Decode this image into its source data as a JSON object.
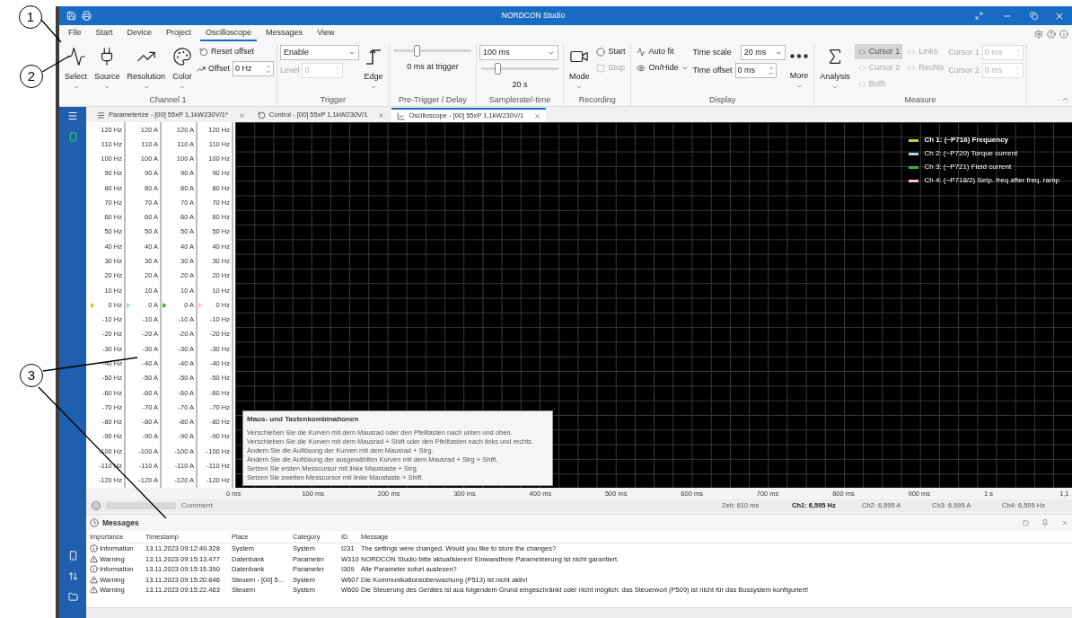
{
  "callouts": [
    {
      "label": "1"
    },
    {
      "label": "2"
    },
    {
      "label": "3"
    }
  ],
  "window": {
    "title": "NORDCON Studio"
  },
  "menu_tabs": [
    {
      "label": "File",
      "selected": false
    },
    {
      "label": "Start",
      "selected": false
    },
    {
      "label": "Device",
      "selected": false
    },
    {
      "label": "Project",
      "selected": false
    },
    {
      "label": "Oscilloscope",
      "selected": true
    },
    {
      "label": "Messages",
      "selected": false
    },
    {
      "label": "View",
      "selected": false
    }
  ],
  "ribbon": {
    "groups": [
      {
        "label": "Channel 1",
        "columns": [
          [
            {
              "kind": "big",
              "label": "Select"
            }
          ],
          [
            {
              "kind": "big",
              "label": "Source"
            }
          ],
          [
            {
              "kind": "big",
              "label": "Resolution"
            }
          ],
          [
            {
              "kind": "big",
              "label": "Color"
            }
          ],
          [
            {
              "kind": "small",
              "label": "Reset offset",
              "dropdown": false
            },
            {
              "kind": "spin",
              "label": "Offset",
              "value": "0 Hz"
            }
          ]
        ]
      },
      {
        "label": "Trigger",
        "columns": [
          [
            {
              "kind": "dropdown",
              "value": "Enable",
              "disabled": false
            },
            {
              "kind": "spin",
              "label": "Level",
              "value": "0",
              "disabled": true
            }
          ],
          [
            {
              "kind": "big",
              "label": "Edge"
            }
          ]
        ]
      },
      {
        "label": "Pre-Trigger / Delay",
        "columns": [
          [
            {
              "kind": "slider",
              "level": 0.28
            },
            {
              "kind": "caption",
              "label": "0 ms at trigger"
            }
          ]
        ]
      },
      {
        "label": "Samplerate/-time",
        "columns": [
          [
            {
              "kind": "dropdown",
              "value": "100 ms"
            },
            {
              "kind": "slider",
              "level": 0.2
            },
            {
              "kind": "caption",
              "label": "20 s"
            }
          ]
        ]
      },
      {
        "label": "Recording",
        "columns": [
          [
            {
              "kind": "big",
              "label": "Mode"
            }
          ],
          [
            {
              "kind": "small",
              "label": "Start",
              "dropdown": false,
              "disabled": false
            },
            {
              "kind": "small",
              "label": "Stop",
              "dropdown": false,
              "disabled": true
            }
          ]
        ]
      },
      {
        "label": "Display",
        "columns": [
          [
            {
              "kind": "small",
              "label": "Auto fit",
              "dropdown": false
            },
            {
              "kind": "small",
              "label": "On/Hide",
              "dropdown": true
            }
          ],
          [
            {
              "kind": "dropdown",
              "label": "Time scale",
              "value": "20 ms"
            },
            {
              "kind": "spin",
              "label": "Time offset",
              "value": "0 ms"
            }
          ],
          [
            {
              "kind": "big",
              "label": "More"
            }
          ]
        ]
      },
      {
        "label": "Measure",
        "columns": [
          [
            {
              "kind": "big",
              "label": "Analysis"
            }
          ],
          [
            {
              "kind": "toggle",
              "label": "Cursor 1",
              "selected": true,
              "disabled": true
            },
            {
              "kind": "toggle",
              "label": "Cursor 2",
              "selected": false,
              "disabled": true
            },
            {
              "kind": "toggle",
              "label": "Both",
              "selected": false,
              "disabled": true
            }
          ],
          [
            {
              "kind": "small",
              "label": "Links",
              "dropdown": false,
              "disabled": true
            },
            {
              "kind": "small",
              "label": "Rechts",
              "dropdown": false,
              "disabled": true
            }
          ],
          [
            {
              "kind": "spin",
              "label": "Cursor 1",
              "value": "0 ms",
              "disabled": true
            },
            {
              "kind": "spin",
              "label": "Cursor 2",
              "value": "0 ms",
              "disabled": true
            }
          ]
        ]
      }
    ]
  },
  "doc_tabs": [
    {
      "label": "Parameterize - [00] 55xP 1,1kW230V/1*",
      "selected": false
    },
    {
      "label": "Control - [00] 55xP 1,1kW230V/1",
      "selected": false
    },
    {
      "label": "Oscilloscope - [00] 55xP 1,1kW230V/1",
      "selected": true
    }
  ],
  "axes": [
    {
      "color": "#b5d334",
      "ticks": [
        "120 Hz",
        "110 Hz",
        "100 Hz",
        "90 Hz",
        "80 Hz",
        "70 Hz",
        "60 Hz",
        "50 Hz",
        "40 Hz",
        "30 Hz",
        "20 Hz",
        "10 Hz",
        "0 Hz",
        "-10 Hz",
        "-20 Hz",
        "-30 Hz",
        "-40 Hz",
        "-50 Hz",
        "-60 Hz",
        "-70 Hz",
        "-80 Hz",
        "-90 Hz",
        "-100 Hz",
        "-110 Hz",
        "-120 Hz"
      ]
    },
    {
      "color": "#a8d8e8",
      "ticks": [
        "120 A",
        "110 A",
        "100 A",
        "90 A",
        "80 A",
        "70 A",
        "60 A",
        "50 A",
        "40 A",
        "30 A",
        "20 A",
        "10 A",
        "0 A",
        "-10 A",
        "-20 A",
        "-30 A",
        "-40 A",
        "-50 A",
        "-60 A",
        "-70 A",
        "-80 A",
        "-90 A",
        "-100 A",
        "-110 A",
        "-120 A"
      ]
    },
    {
      "color": "#3cb043",
      "ticks": [
        "120 A",
        "110 A",
        "100 A",
        "90 A",
        "80 A",
        "70 A",
        "60 A",
        "50 A",
        "40 A",
        "30 A",
        "20 A",
        "10 A",
        "0 A",
        "-10 A",
        "-20 A",
        "-30 A",
        "-40 A",
        "-50 A",
        "-60 A",
        "-70 A",
        "-80 A",
        "-90 A",
        "-100 A",
        "-110 A",
        "-120 A"
      ]
    },
    {
      "color": "#f4c2d0",
      "ticks": [
        "120 Hz",
        "110 Hz",
        "100 Hz",
        "90 Hz",
        "80 Hz",
        "70 Hz",
        "60 Hz",
        "50 Hz",
        "40 Hz",
        "30 Hz",
        "20 Hz",
        "10 Hz",
        "0 Hz",
        "-10 Hz",
        "-20 Hz",
        "-30 Hz",
        "-40 Hz",
        "-50 Hz",
        "-60 Hz",
        "-70 Hz",
        "-80 Hz",
        "-90 Hz",
        "-100 Hz",
        "-110 Hz",
        "-120 Hz"
      ]
    }
  ],
  "legend": [
    {
      "label": "Ch 1: (~P716) Frequency",
      "color": "#b5d334",
      "selected": true
    },
    {
      "label": "Ch 2: (~P720) Torque current",
      "color": "#a8d8e8",
      "selected": false
    },
    {
      "label": "Ch 3: (~P721) Field current",
      "color": "#3cb043",
      "selected": false
    },
    {
      "label": "Ch 4: (~P718/2) Setp. freq after freq. ramp",
      "color": "#f4c2d0",
      "selected": false
    }
  ],
  "tooltip": {
    "title": "Maus- und Tastenkombinationen",
    "lines": [
      "Verschieben Sie die Kurven mit dem Mausrad oder den Pfeiltasten nach unten und oben.",
      "Verschieben Sie die Kurven mit dem Mausrad + Shift oder den Pfeiltasten nach links und rechts.",
      "Ändern Sie die Auflösung der Kurven mit dem Mausrad + Strg.",
      "Ändern Sie die Auflösung der ausgewählten Kurven mit dem Mausrad + Strg + Shift.",
      "Setzen Sie ersten Messcursor mit linke Maustaste + Strg.",
      "Setzen Sie zweiten Messcursor mit linke Maustaste + Shift."
    ]
  },
  "x_ticks": [
    "0 ms",
    "100 ms",
    "200 ms",
    "300 ms",
    "400 ms",
    "500 ms",
    "600 ms",
    "700 ms",
    "800 ms",
    "900 ms",
    "1 s",
    "1,1"
  ],
  "comment": {
    "label": "Comment"
  },
  "readouts": [
    {
      "label": "Zeit: 610 ms",
      "selected": false
    },
    {
      "label": "Ch1: 6,595 Hz",
      "selected": true
    },
    {
      "label": "Ch2: 6,595 A",
      "selected": false
    },
    {
      "label": "Ch3: 6,595 A",
      "selected": false
    },
    {
      "label": "Ch4: 6,595 Hz",
      "selected": false
    }
  ],
  "messages": {
    "title": "Messages",
    "columns": [
      "Importance",
      "Timestamp",
      "Place",
      "Category",
      "ID",
      "Message"
    ],
    "rows": [
      {
        "kind": "information",
        "cells": [
          "Information",
          "13.11.2023 09:12:49.328",
          "System",
          "System",
          "I231",
          "The settings were changed. Would you like to store the changes?"
        ]
      },
      {
        "kind": "warning",
        "cells": [
          "Warning",
          "13.11.2023 09:15:13.477",
          "Datenbank",
          "Parameter",
          "W310",
          "NORDCON Studio bitte aktualisieren! Einwandfreie Parametrierung ist nicht garantiert."
        ]
      },
      {
        "kind": "information",
        "cells": [
          "Information",
          "13.11.2023 09:15:15.390",
          "Datenbank",
          "Parameter",
          "I309",
          "Alle Parameter sofort auslesen?"
        ]
      },
      {
        "kind": "warning",
        "cells": [
          "Warning",
          "13.11.2023 09:15:20.846",
          "Steuern - [00] 5...",
          "System",
          "W607",
          "Die Kommunikationsüberwachung (P513) ist nicht aktiv!"
        ]
      },
      {
        "kind": "warning",
        "cells": [
          "Warning",
          "13.11.2023 09:15:22.463",
          "Steuern",
          "System",
          "W600",
          "Die Steuerung des Gerätes ist aus folgendem Grund eingeschränkt oder nicht möglich: das Steuerwort (P509) ist nicht für das Bussystem konfiguriert!"
        ]
      }
    ]
  }
}
